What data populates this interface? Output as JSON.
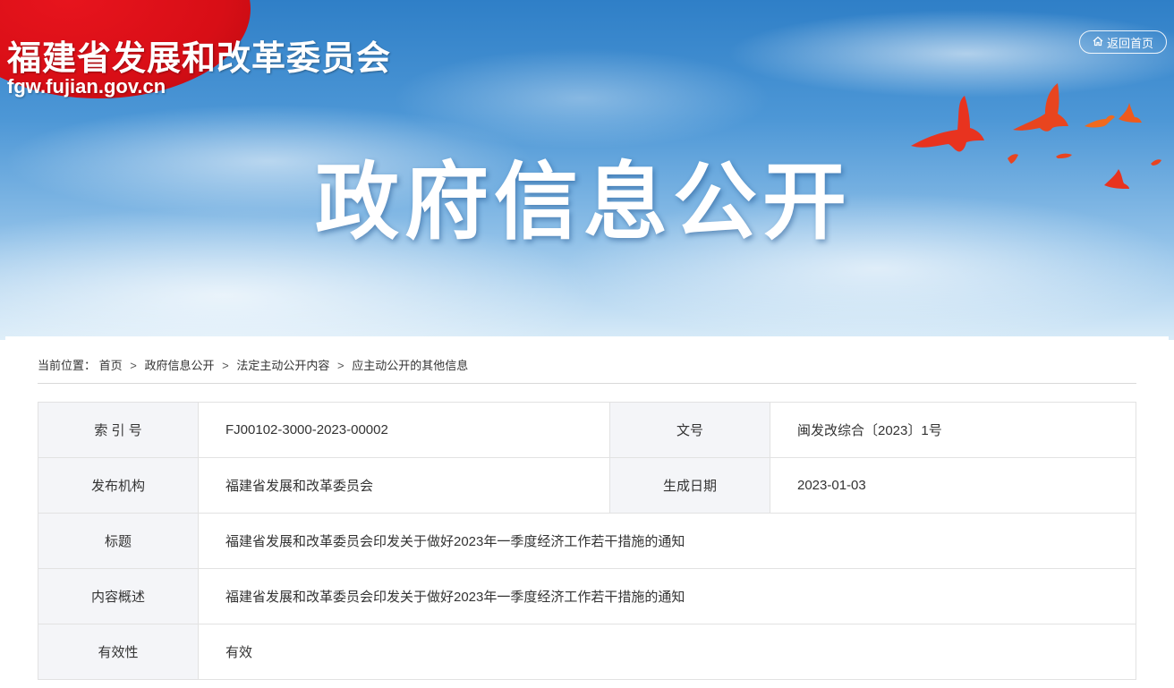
{
  "header": {
    "site_title": "福建省发展和改革委员会",
    "site_domain": "fgw.fujian.gov.cn",
    "home_button_label": "返回首页",
    "hero_title": "政府信息公开"
  },
  "breadcrumb": {
    "prefix": "当前位置：",
    "items": [
      "首页",
      "政府信息公开",
      "法定主动公开内容",
      "应主动公开的其他信息"
    ],
    "separator": ">"
  },
  "metadata": {
    "index_label": "索 引 号",
    "index_value": "FJ00102-3000-2023-00002",
    "doc_no_label": "文号",
    "doc_no_value": "闽发改综合〔2023〕1号",
    "publisher_label": "发布机构",
    "publisher_value": "福建省发展和改革委员会",
    "date_label": "生成日期",
    "date_value": "2023-01-03",
    "title_label": "标题",
    "title_value": "福建省发展和改革委员会印发关于做好2023年一季度经济工作若干措施的通知",
    "summary_label": "内容概述",
    "summary_value": "福建省发展和改革委员会印发关于做好2023年一季度经济工作若干措施的通知",
    "validity_label": "有效性",
    "validity_value": "有效"
  },
  "colors": {
    "brand_red": "#d80e16",
    "sky_blue": "#2f7fc7",
    "label_bg": "#f4f5f8"
  },
  "icons": [
    "home-icon",
    "bird-icon"
  ]
}
